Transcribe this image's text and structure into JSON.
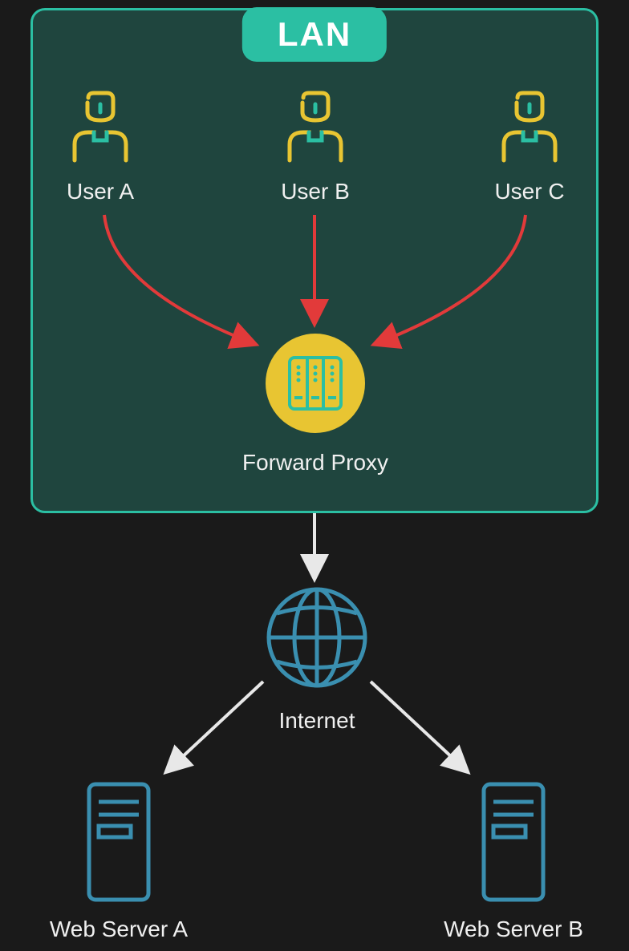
{
  "lan": {
    "badge": "LAN",
    "users": [
      {
        "label": "User A"
      },
      {
        "label": "User B"
      },
      {
        "label": "User C"
      }
    ],
    "proxy": {
      "label": "Forward Proxy"
    }
  },
  "internet": {
    "label": "Internet"
  },
  "servers": [
    {
      "label": "Web Server A"
    },
    {
      "label": "Web Server B"
    }
  ],
  "colors": {
    "accent_teal": "#2bbfa3",
    "bg_dark": "#1a1a1a",
    "lan_fill": "#1f453e",
    "user_yellow": "#e8c532",
    "arrow_red": "#e23a3a",
    "arrow_white": "#e8e8e8",
    "globe_blue": "#3a8fb0",
    "server_blue": "#3a8fb0",
    "proxy_yellow": "#e8c532"
  },
  "diagram": {
    "arrows": [
      {
        "from": "User A",
        "to": "Forward Proxy",
        "color": "red"
      },
      {
        "from": "User B",
        "to": "Forward Proxy",
        "color": "red"
      },
      {
        "from": "User C",
        "to": "Forward Proxy",
        "color": "red"
      },
      {
        "from": "Forward Proxy",
        "to": "Internet",
        "color": "white"
      },
      {
        "from": "Internet",
        "to": "Web Server A",
        "color": "white"
      },
      {
        "from": "Internet",
        "to": "Web Server B",
        "color": "white"
      }
    ]
  }
}
